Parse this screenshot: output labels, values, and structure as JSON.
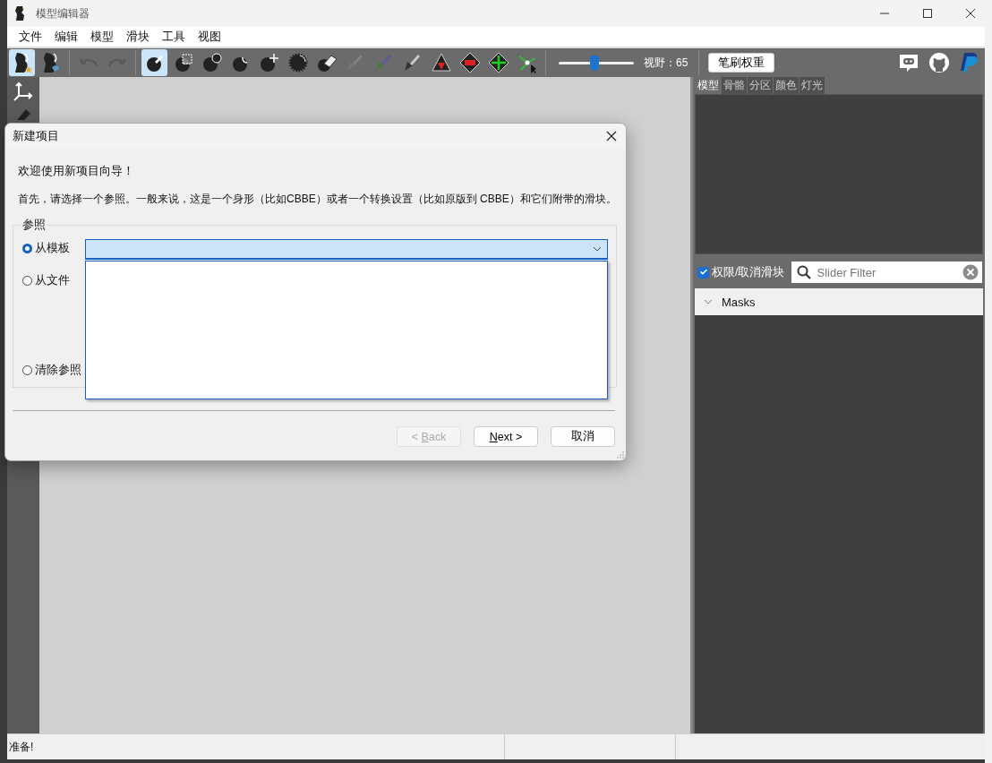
{
  "window": {
    "title": "模型编辑器"
  },
  "menu": [
    "文件",
    "编辑",
    "模型",
    "滑块",
    "工具",
    "视图"
  ],
  "toolbar": {
    "tools": [
      {
        "kind": "figure",
        "selected": true,
        "disabled": false
      },
      {
        "kind": "figure-alt",
        "selected": false,
        "disabled": false
      },
      {
        "kind": "undo",
        "selected": false,
        "disabled": true
      },
      {
        "kind": "redo",
        "selected": false,
        "disabled": true
      },
      {
        "kind": "ball-brush",
        "selected": true,
        "disabled": false
      },
      {
        "kind": "mask",
        "selected": false,
        "disabled": false
      },
      {
        "kind": "inflate",
        "selected": false,
        "disabled": false
      },
      {
        "kind": "deflate",
        "selected": false,
        "disabled": false
      },
      {
        "kind": "move",
        "selected": false,
        "disabled": false
      },
      {
        "kind": "smooth",
        "selected": false,
        "disabled": false
      },
      {
        "kind": "eraser",
        "selected": false,
        "disabled": false
      },
      {
        "kind": "weight-brush",
        "selected": false,
        "disabled": true
      },
      {
        "kind": "color-brush",
        "selected": false,
        "disabled": false
      },
      {
        "kind": "alpha-brush",
        "selected": false,
        "disabled": false
      },
      {
        "kind": "triangle",
        "selected": false,
        "disabled": false
      },
      {
        "kind": "diamond-red",
        "selected": false,
        "disabled": false
      },
      {
        "kind": "diamond-green",
        "selected": false,
        "disabled": false
      },
      {
        "kind": "nodes",
        "selected": false,
        "disabled": false
      }
    ],
    "fov": {
      "level": 0.48,
      "reading": "视野：65"
    },
    "brush_weight_button": "笔刷权重"
  },
  "side_panel": {
    "tabs": [
      {
        "label": "模型",
        "selected": true
      },
      {
        "label": "骨骼",
        "selected": false
      },
      {
        "label": "分区",
        "selected": false
      },
      {
        "label": "颜色",
        "selected": false
      },
      {
        "label": "灯光",
        "selected": false
      }
    ],
    "slider_toggle": {
      "label": "权限/取消滑块",
      "checked": true
    },
    "filter": {
      "placeholder": "Slider Filter"
    },
    "sections": [
      {
        "label": "Masks"
      }
    ]
  },
  "dialog": {
    "title": "新建项目",
    "welcome": "欢迎使用新项目向导！",
    "intro": "首先，请选择一个参照。一般来说，这是一个身形（比如CBBE）或者一个转换设置（比如原版到 CBBE）和它们附带的滑块。",
    "group": "参照",
    "options": [
      {
        "label": "从模板",
        "selected": true
      },
      {
        "label": "从文件",
        "selected": false
      },
      {
        "label": "清除参照",
        "selected": false
      }
    ],
    "template_dropdown": {
      "expanded": true
    },
    "buttons": [
      {
        "pre": "< ",
        "key": "B",
        "post": "ack",
        "disabled": true
      },
      {
        "key": "N",
        "post": "ext >",
        "disabled": false
      },
      {
        "post": "取消",
        "disabled": false
      }
    ]
  },
  "status_bar": [
    "准备!"
  ]
}
